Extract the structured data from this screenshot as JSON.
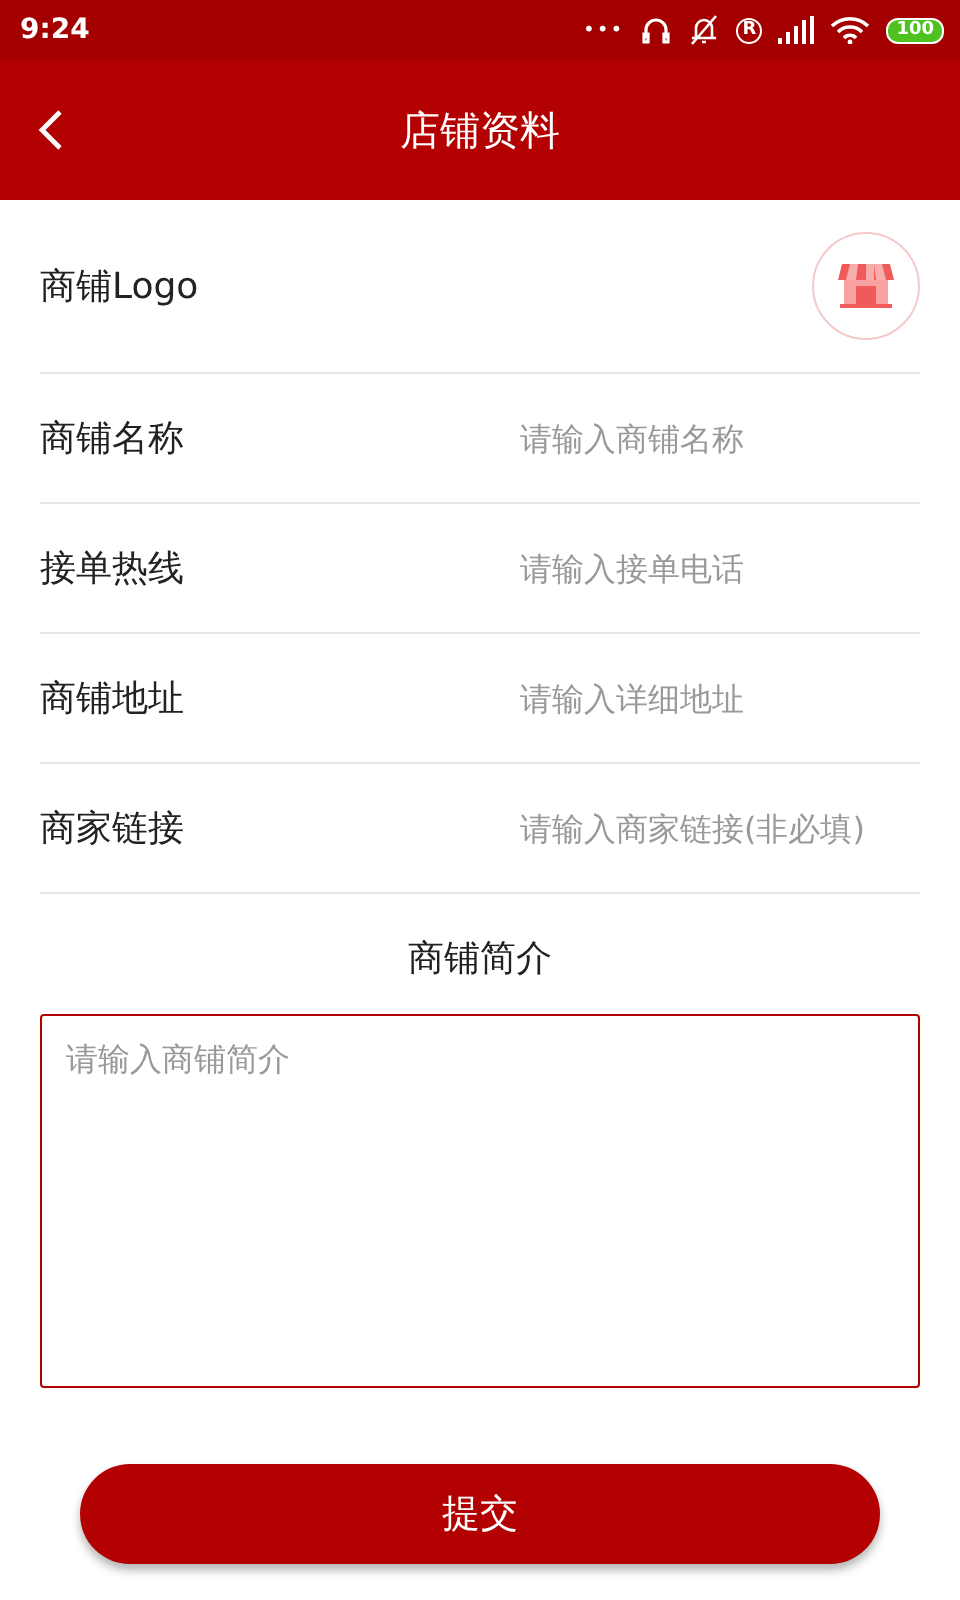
{
  "status_bar": {
    "time": "9:24",
    "dots": "•••",
    "ring_mark": "R",
    "battery": "100"
  },
  "header": {
    "title": "店铺资料"
  },
  "logo_row": {
    "label": "商铺Logo"
  },
  "fields": [
    {
      "label": "商铺名称",
      "placeholder": "请输入商铺名称"
    },
    {
      "label": "接单热线",
      "placeholder": "请输入接单电话"
    },
    {
      "label": "商铺地址",
      "placeholder": "请输入详细地址"
    },
    {
      "label": "商家链接",
      "placeholder": "请输入商家链接(非必填)"
    }
  ],
  "intro": {
    "title": "商铺简介",
    "placeholder": "请输入商铺简介"
  },
  "submit": {
    "label": "提交"
  }
}
